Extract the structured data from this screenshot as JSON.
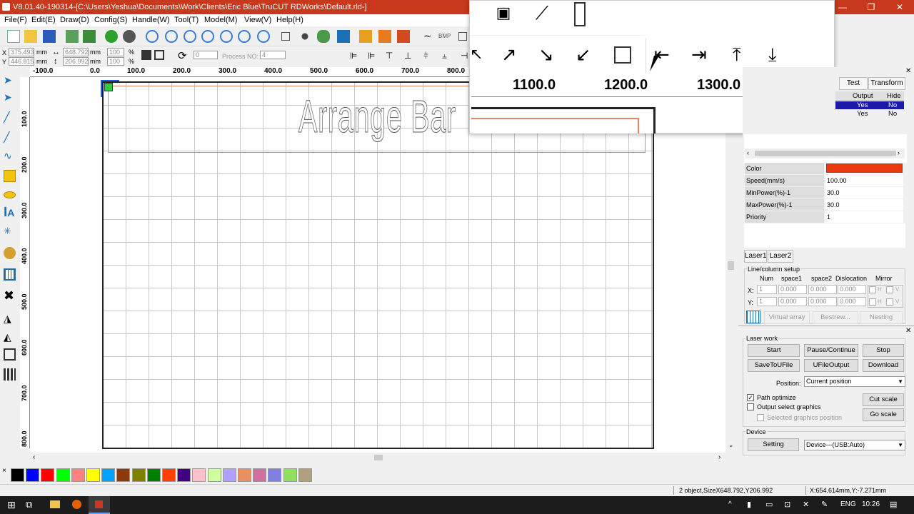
{
  "window": {
    "title": "V8.01.40-190314-[C:\\Users\\Yeshua\\Documents\\Work\\Clients\\Eric Blue\\TruCUT RDWorks\\Default.rld-]",
    "minimize": "—",
    "restore": "❐",
    "close": "✕"
  },
  "menu": [
    "File(F)",
    "Edit(E)",
    "Draw(D)",
    "Config(S)",
    "Handle(W)",
    "Tool(T)",
    "Model(M)",
    "View(V)",
    "Help(H)"
  ],
  "coords": {
    "x_label": "X",
    "x_value": "375.493",
    "x_unit": "mm",
    "y_label": "Y",
    "y_value": "446.815",
    "y_unit": "mm",
    "width_value": "648.792",
    "width_unit": "mm",
    "height_value": "206.992",
    "height_unit": "mm",
    "scale_x": "100",
    "scale_y": "100",
    "pct1": "%",
    "pct2": "%",
    "rotate_value": "0",
    "process_label": "Process NO:",
    "process_value": "4"
  },
  "ruler_h": [
    "-100.0",
    "0.0",
    "100.0",
    "200.0",
    "300.0",
    "400.0",
    "500.0",
    "600.0",
    "700.0",
    "800.0"
  ],
  "ruler_v": [
    "100.0",
    "200.0",
    "300.0",
    "400.0",
    "500.0",
    "600.0",
    "700.0",
    "800.0"
  ],
  "canvas": {
    "object_text": "Arrange Bar"
  },
  "popup_ruler": [
    "1100.0",
    "1200.0",
    "1300.0"
  ],
  "popup_icons_top": [
    "projector-icon",
    "magic-wand-icon",
    "ruler-icon"
  ],
  "popup_icons_bottom": [
    "align-top-left-icon",
    "align-top-right-icon",
    "align-bottom-right-icon",
    "align-bottom-left-icon",
    "align-center-icon",
    "align-left-icon",
    "align-right-icon",
    "align-top-icon",
    "align-bottom-icon"
  ],
  "palette": [
    "#000000",
    "#0000ff",
    "#ff0000",
    "#00ff00",
    "#ff8080",
    "#ffff00",
    "#00a2ff",
    "#8b3a0f",
    "#808000",
    "#008000",
    "#ff4000",
    "#400080",
    "#ffc0cb",
    "#d0ffa0",
    "#b0a0ff",
    "#e89060",
    "#d070a0",
    "#8080e0",
    "#90e060",
    "#b0a080"
  ],
  "layers": {
    "tabs": [
      "Test",
      "Transform"
    ],
    "headers": [
      "Output",
      "Hide"
    ],
    "rows": [
      {
        "output": "Yes",
        "hide": "No",
        "selected": true
      },
      {
        "output": "Yes",
        "hide": "No",
        "selected": false
      }
    ]
  },
  "properties": [
    {
      "key": "Color",
      "value": "",
      "color": "#e8380d"
    },
    {
      "key": "Speed(mm/s)",
      "value": "100.00"
    },
    {
      "key": "MinPower(%)-1",
      "value": "30.0"
    },
    {
      "key": "MaxPower(%)-1",
      "value": "30.0"
    },
    {
      "key": "Priority",
      "value": "1"
    }
  ],
  "laser_tabs": [
    "Laser1",
    "Laser2"
  ],
  "array": {
    "group_title": "Line/column setup",
    "headers": [
      "Num",
      "space1",
      "space2",
      "Dislocation",
      "Mirror"
    ],
    "x_label": "X:",
    "y_label": "Y:",
    "x_num": "1",
    "y_num": "1",
    "x_vals": [
      "0.000",
      "0.000",
      "0.000"
    ],
    "y_vals": [
      "0.000",
      "0.000",
      "0.000"
    ],
    "mirror_h": "H",
    "mirror_v": "V",
    "buttons": [
      "Virtual array",
      "Bestrew...",
      "Nesting"
    ]
  },
  "laser_work": {
    "title": "Laser work",
    "buttons": [
      "Start",
      "Pause/Continue",
      "Stop",
      "SaveToUFile",
      "UFileOutput",
      "Download"
    ],
    "position_label": "Position:",
    "position_value": "Current position",
    "path_optimize": "Path optimize",
    "output_select": "Output select graphics",
    "selected_position": "Selected graphics position",
    "cut_scale": "Cut scale",
    "go_scale": "Go scale"
  },
  "device": {
    "title": "Device",
    "setting": "Setting",
    "value": "Device---(USB:Auto)"
  },
  "status": {
    "object_info": "2 object,SizeX648.792,Y206.992",
    "cursor_info": "X:654.614mm,Y:-7.271mm"
  },
  "taskbar": {
    "language": "ENG",
    "time": "10:26"
  }
}
